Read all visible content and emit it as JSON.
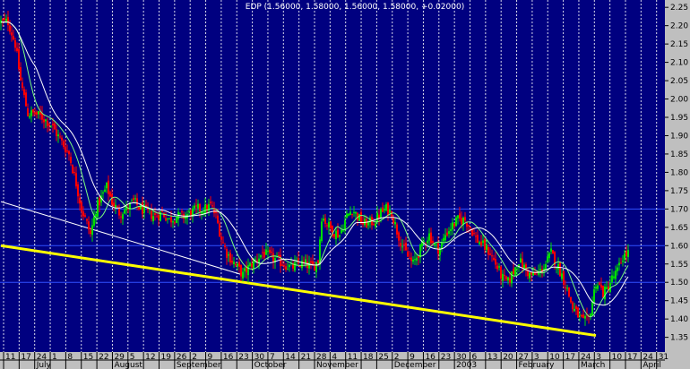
{
  "chart_data": {
    "type": "candlestick",
    "title": "EDP (1.56000, 1.58000, 1.56000, 1.58000, +0.02000)",
    "ylim": [
      1.31,
      2.27
    ],
    "y_ticks": [
      "2.25",
      "2.20",
      "2.15",
      "2.10",
      "2.05",
      "2.00",
      "1.95",
      "1.90",
      "1.85",
      "1.80",
      "1.75",
      "1.70",
      "1.65",
      "1.60",
      "1.55",
      "1.50",
      "1.45",
      "1.40",
      "1.35"
    ],
    "day_labels": [
      "11",
      "17",
      "24",
      "1",
      "8",
      "15",
      "22",
      "29",
      "5",
      "12",
      "19",
      "26",
      "2",
      "9",
      "16",
      "23",
      "30",
      "7",
      "14",
      "21",
      "28",
      "4",
      "11",
      "18",
      "25",
      "2",
      "9",
      "16",
      "23",
      "30",
      "6",
      "13",
      "20",
      "27",
      "3",
      "10",
      "17",
      "24",
      "3",
      "10",
      "17",
      "24",
      "31"
    ],
    "month_labels": [
      "July",
      "August",
      "September",
      "October",
      "November",
      "December",
      "2003",
      "February",
      "March",
      "April"
    ],
    "colors": {
      "background": "#000080",
      "up_candle": "#00dd00",
      "down_candle": "#ff0000",
      "ma_short": "#7cff7c",
      "ma_long": "#ffffff",
      "support_line": "#ffff00",
      "trend_line": "#ffffff",
      "grid_vertical": "#ffffff",
      "grid_horizontal": "#3050ff",
      "axis_strip": "#bfbfbf"
    },
    "anchors": [
      [
        0,
        2.21
      ],
      [
        8,
        2.21
      ],
      [
        16,
        2.15
      ],
      [
        22,
        2.05
      ],
      [
        30,
        1.96
      ],
      [
        38,
        1.96
      ],
      [
        46,
        1.95
      ],
      [
        56,
        1.93
      ],
      [
        66,
        1.89
      ],
      [
        76,
        1.85
      ],
      [
        84,
        1.77
      ],
      [
        90,
        1.7
      ],
      [
        96,
        1.66
      ],
      [
        100,
        1.63
      ],
      [
        106,
        1.7
      ],
      [
        112,
        1.73
      ],
      [
        118,
        1.76
      ],
      [
        124,
        1.72
      ],
      [
        132,
        1.69
      ],
      [
        140,
        1.7
      ],
      [
        148,
        1.72
      ],
      [
        156,
        1.7
      ],
      [
        164,
        1.69
      ],
      [
        172,
        1.68
      ],
      [
        180,
        1.69
      ],
      [
        188,
        1.67
      ],
      [
        196,
        1.68
      ],
      [
        204,
        1.68
      ],
      [
        212,
        1.69
      ],
      [
        220,
        1.7
      ],
      [
        228,
        1.7
      ],
      [
        234,
        1.71
      ],
      [
        240,
        1.68
      ],
      [
        246,
        1.62
      ],
      [
        252,
        1.58
      ],
      [
        258,
        1.56
      ],
      [
        264,
        1.54
      ],
      [
        270,
        1.52
      ],
      [
        276,
        1.54
      ],
      [
        284,
        1.56
      ],
      [
        292,
        1.58
      ],
      [
        300,
        1.57
      ],
      [
        308,
        1.56
      ],
      [
        316,
        1.55
      ],
      [
        324,
        1.54
      ],
      [
        332,
        1.55
      ],
      [
        340,
        1.55
      ],
      [
        348,
        1.54
      ],
      [
        354,
        1.56
      ],
      [
        358,
        1.68
      ],
      [
        364,
        1.66
      ],
      [
        370,
        1.64
      ],
      [
        378,
        1.63
      ],
      [
        386,
        1.68
      ],
      [
        392,
        1.7
      ],
      [
        398,
        1.68
      ],
      [
        404,
        1.66
      ],
      [
        410,
        1.66
      ],
      [
        418,
        1.67
      ],
      [
        424,
        1.69
      ],
      [
        430,
        1.7
      ],
      [
        436,
        1.69
      ],
      [
        442,
        1.64
      ],
      [
        448,
        1.6
      ],
      [
        454,
        1.57
      ],
      [
        460,
        1.55
      ],
      [
        466,
        1.58
      ],
      [
        472,
        1.61
      ],
      [
        478,
        1.63
      ],
      [
        484,
        1.6
      ],
      [
        490,
        1.59
      ],
      [
        496,
        1.63
      ],
      [
        502,
        1.65
      ],
      [
        510,
        1.67
      ],
      [
        518,
        1.67
      ],
      [
        524,
        1.65
      ],
      [
        530,
        1.62
      ],
      [
        538,
        1.6
      ],
      [
        546,
        1.58
      ],
      [
        554,
        1.54
      ],
      [
        560,
        1.51
      ],
      [
        566,
        1.5
      ],
      [
        572,
        1.53
      ],
      [
        578,
        1.56
      ],
      [
        584,
        1.54
      ],
      [
        590,
        1.52
      ],
      [
        596,
        1.52
      ],
      [
        602,
        1.53
      ],
      [
        608,
        1.55
      ],
      [
        614,
        1.58
      ],
      [
        620,
        1.55
      ],
      [
        626,
        1.52
      ],
      [
        632,
        1.48
      ],
      [
        638,
        1.43
      ],
      [
        644,
        1.41
      ],
      [
        650,
        1.39
      ],
      [
        656,
        1.4
      ],
      [
        660,
        1.45
      ],
      [
        664,
        1.5
      ],
      [
        668,
        1.49
      ],
      [
        672,
        1.47
      ],
      [
        676,
        1.48
      ],
      [
        682,
        1.51
      ],
      [
        688,
        1.53
      ],
      [
        694,
        1.57
      ],
      [
        700,
        1.58
      ]
    ],
    "support_line": [
      [
        0,
        1.6
      ],
      [
        664,
        1.355
      ]
    ],
    "trend_line": [
      [
        0,
        1.72
      ],
      [
        270,
        1.52
      ]
    ]
  }
}
